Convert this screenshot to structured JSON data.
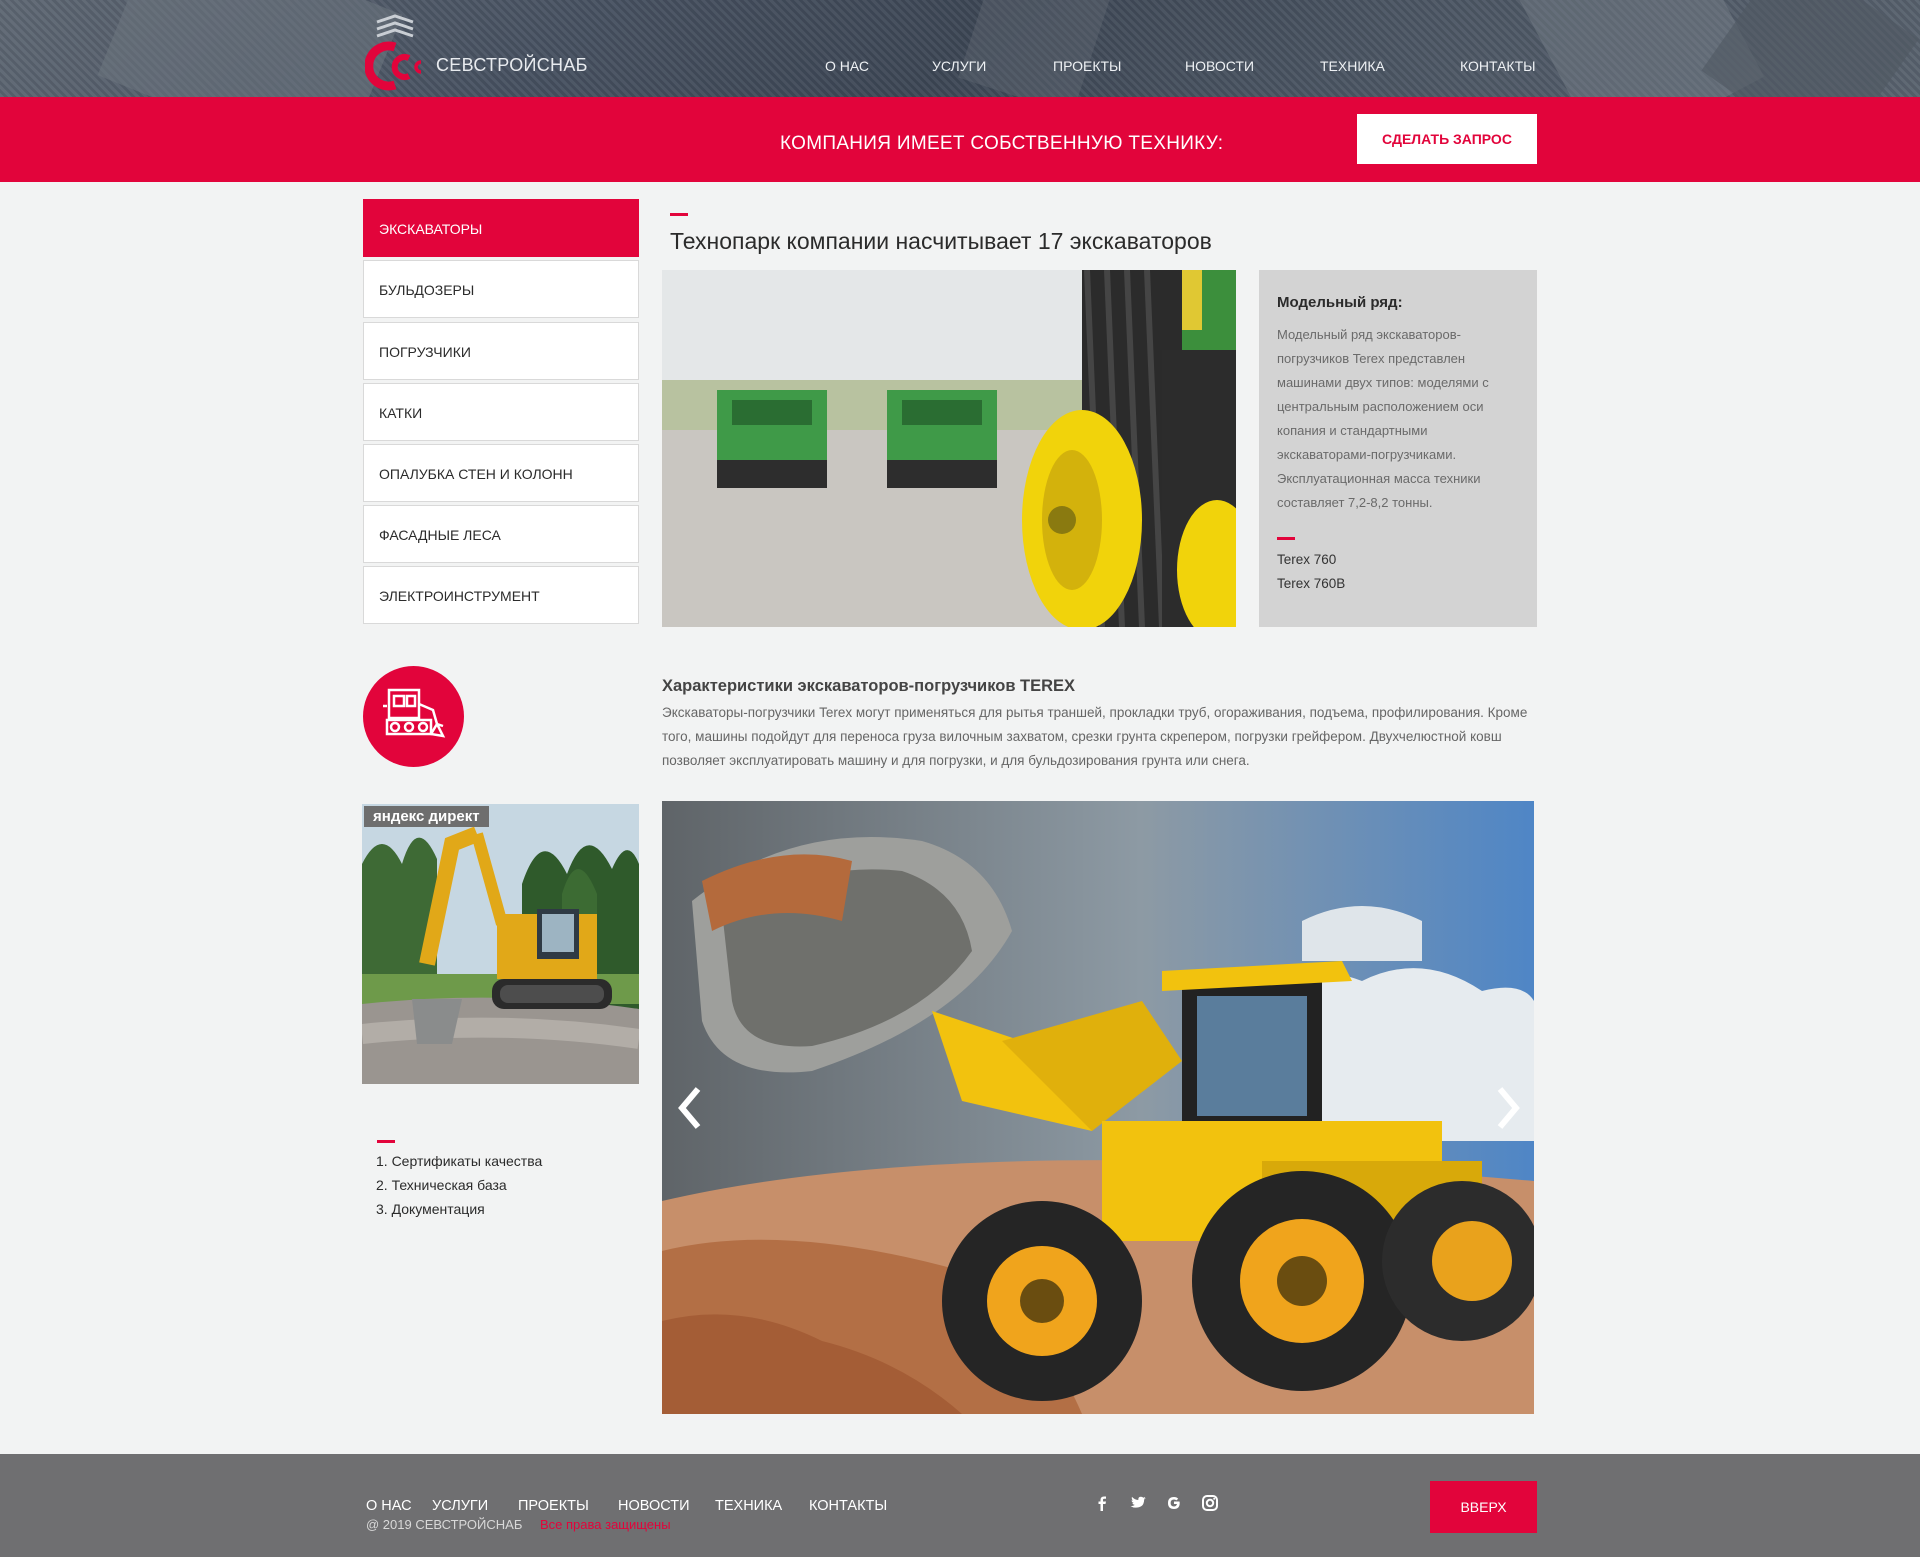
{
  "header": {
    "brand": "СЕВСТРОЙСНАБ",
    "nav": [
      "О НАС",
      "УСЛУГИ",
      "ПРОЕКТЫ",
      "НОВОСТИ",
      "ТЕХНИКА",
      "КОНТАКТЫ"
    ]
  },
  "banner": {
    "title": "КОМПАНИЯ ИМЕЕТ СОБСТВЕННУЮ ТЕХНИКУ:",
    "request_button": "СДЕЛАТЬ ЗАПРОС"
  },
  "sidebar": {
    "items": [
      "ЭКСКАВАТОРЫ",
      "БУЛЬДОЗЕРЫ",
      "ПОГРУЗЧИКИ",
      "КАТКИ",
      "ОПАЛУБКА СТЕН И КОЛОНН",
      "ФАСАДНЫЕ ЛЕСА",
      "ЭЛЕКТРОИНСТРУМЕНТ"
    ],
    "active_index": 0,
    "promo_label": "яндекс директ",
    "links": [
      "1. Сертификаты качества",
      "2. Техническая база",
      "3. Документация"
    ]
  },
  "main": {
    "title": "Технопарк компании насчитывает 17 экскаваторов",
    "info": {
      "heading": "Модельный ряд:",
      "text": "Модельный ряд экскаваторов-погрузчиков Terex представлен машинами двух типов: моделями с центральным расположением оси копания и стандартными экскаваторами-погрузчиками. Эксплуатационная масса техники составляет 7,2-8,2 тонны.",
      "models": [
        "Terex 760",
        "Terex 760B"
      ]
    },
    "characteristics": {
      "title": "Характеристики экскаваторов-погрузчиков TEREX",
      "text": "Экскаваторы-погрузчики Terex могут применяться для рытья траншей, прокладки труб, огораживания, подъема, профилирования. Кроме того, машины подойдут для переноса груза вилочным захватом, срезки грунта скрепером, погрузки грейфером. Двухчелюстной ковш позволяет эксплуатировать машину и для погрузки, и для бульдозирования грунта или снега."
    }
  },
  "footer": {
    "nav": [
      "О НАС",
      "УСЛУГИ",
      "ПРОЕКТЫ",
      "НОВОСТИ",
      "ТЕХНИКА",
      "КОНТАКТЫ"
    ],
    "copyright": "@ 2019 СЕВСТРОЙСНАБ",
    "rights": "Все права защищены",
    "up_button": "ВВЕРХ",
    "social_icons": [
      "facebook-icon",
      "twitter-icon",
      "google-icon",
      "instagram-icon"
    ]
  },
  "colors": {
    "accent": "#e2043b",
    "footer": "#6f6f71",
    "page_bg": "#f2f3f3"
  }
}
